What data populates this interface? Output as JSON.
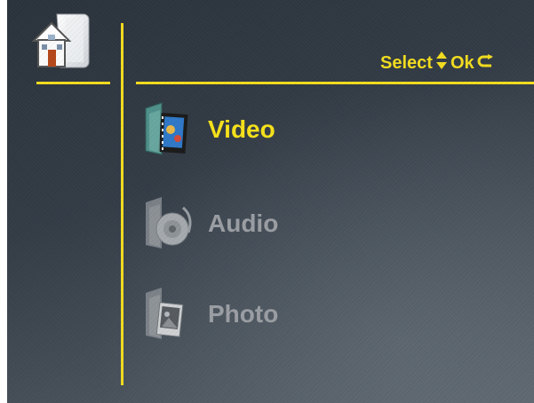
{
  "header": {
    "home_icon": "home-folder-icon",
    "hint": {
      "select_label": "Select",
      "select_icon": "up-down-arrows-icon",
      "ok_label": "Ok",
      "ok_icon": "return-arrow-icon"
    }
  },
  "menu": {
    "selected_index": 0,
    "items": [
      {
        "label": "Video",
        "icon": "video-folder-icon",
        "selected": true
      },
      {
        "label": "Audio",
        "icon": "audio-folder-icon",
        "selected": false
      },
      {
        "label": "Photo",
        "icon": "photo-folder-icon",
        "selected": false
      }
    ]
  },
  "colors": {
    "accent": "#f2dc1f",
    "selected_text": "#f7e21a",
    "unselected_text": "#9a9ea3",
    "background": "#333c46"
  }
}
